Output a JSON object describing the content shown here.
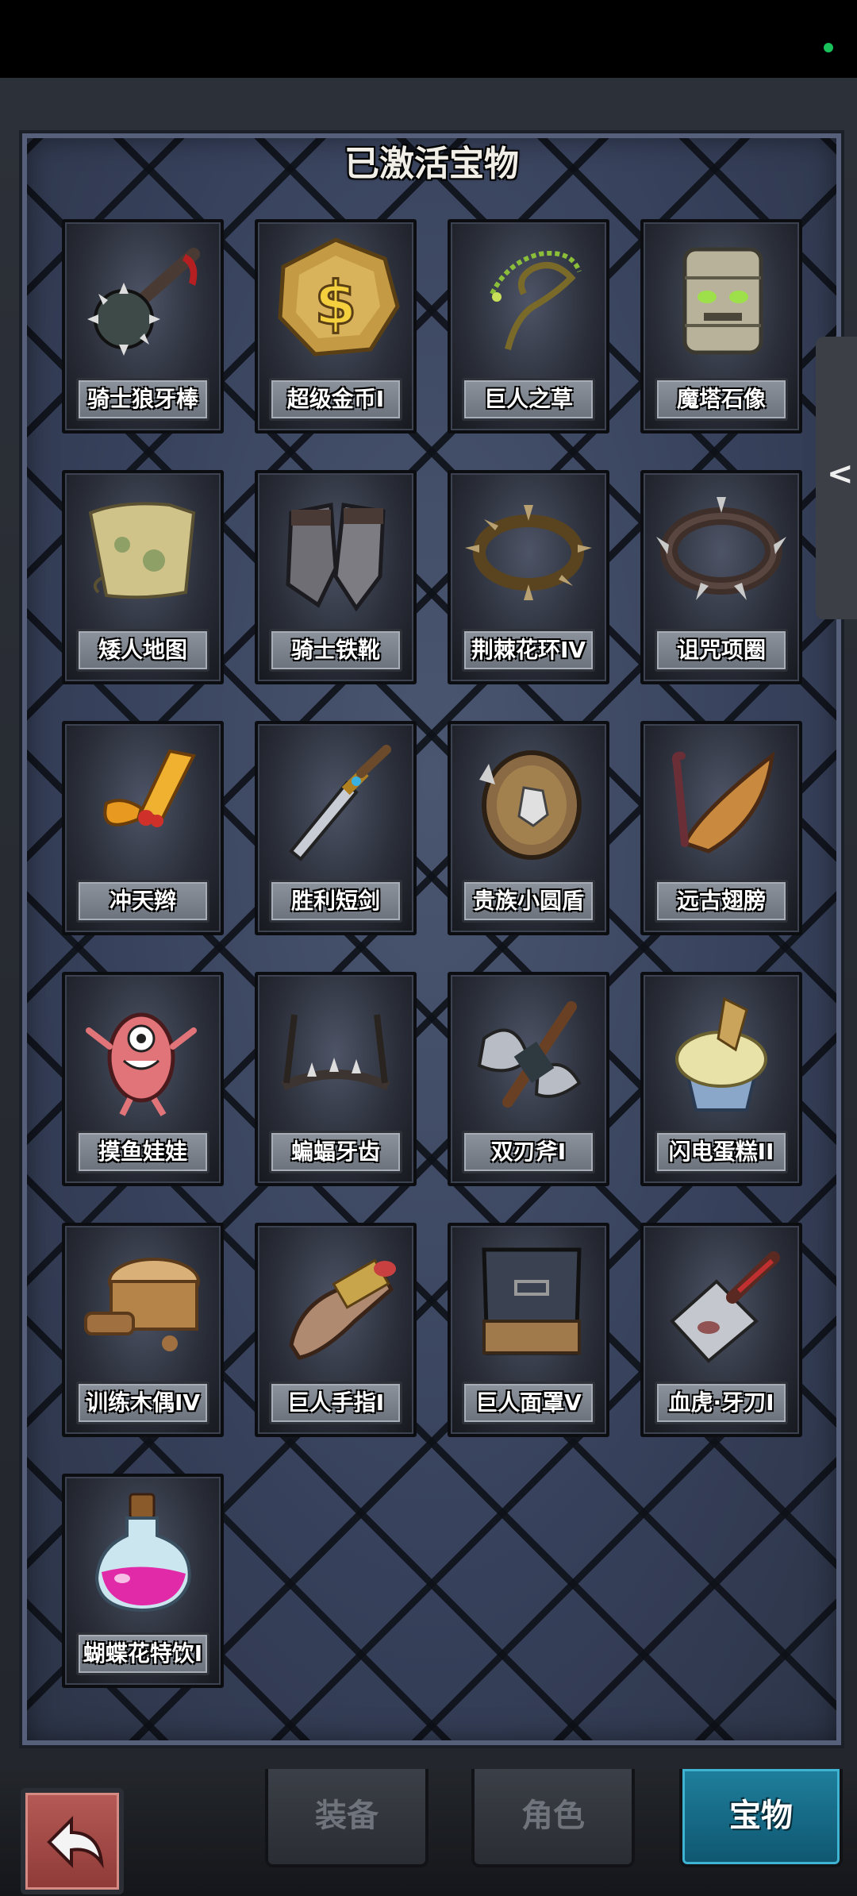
{
  "panel": {
    "title": "已激活宝物"
  },
  "treasures": [
    {
      "label": "骑士狼牙棒",
      "icon": "spiked-mace-icon"
    },
    {
      "label": "超级金币I",
      "icon": "gold-coin-icon"
    },
    {
      "label": "巨人之草",
      "icon": "vine-herb-icon"
    },
    {
      "label": "魔塔石像",
      "icon": "stone-idol-icon"
    },
    {
      "label": "矮人地图",
      "icon": "scroll-map-icon"
    },
    {
      "label": "骑士铁靴",
      "icon": "iron-boots-icon"
    },
    {
      "label": "荆棘花环IV",
      "icon": "thorn-wreath-icon"
    },
    {
      "label": "诅咒项圈",
      "icon": "spiked-collar-icon"
    },
    {
      "label": "冲天辫",
      "icon": "ponytail-icon"
    },
    {
      "label": "胜利短剑",
      "icon": "dagger-icon"
    },
    {
      "label": "贵族小圆盾",
      "icon": "round-shield-icon"
    },
    {
      "label": "远古翅膀",
      "icon": "ancient-wing-icon"
    },
    {
      "label": "摸鱼娃娃",
      "icon": "doll-icon"
    },
    {
      "label": "蝙蝠牙齿",
      "icon": "bat-teeth-icon"
    },
    {
      "label": "双刃斧I",
      "icon": "double-axe-icon"
    },
    {
      "label": "闪电蛋糕II",
      "icon": "cupcake-icon"
    },
    {
      "label": "训练木偶IV",
      "icon": "wooden-dummy-icon"
    },
    {
      "label": "巨人手指I",
      "icon": "giant-finger-icon"
    },
    {
      "label": "巨人面罩V",
      "icon": "giant-mask-icon"
    },
    {
      "label": "血虎·牙刀I",
      "icon": "cleaver-icon"
    },
    {
      "label": "蝴蝶花特饮I",
      "icon": "potion-icon"
    }
  ],
  "side_handle": {
    "glyph": "<",
    "icon": "chevron-left-icon"
  },
  "nav": {
    "back_icon": "back-arrow-icon",
    "tabs": [
      {
        "label": "装备",
        "active": false
      },
      {
        "label": "角色",
        "active": false
      },
      {
        "label": "宝物",
        "active": true
      }
    ]
  },
  "colors": {
    "active_tab": "#1e7f9c",
    "panel": "#384157",
    "back_button": "#b65a56",
    "status_dot": "#19c25a"
  }
}
